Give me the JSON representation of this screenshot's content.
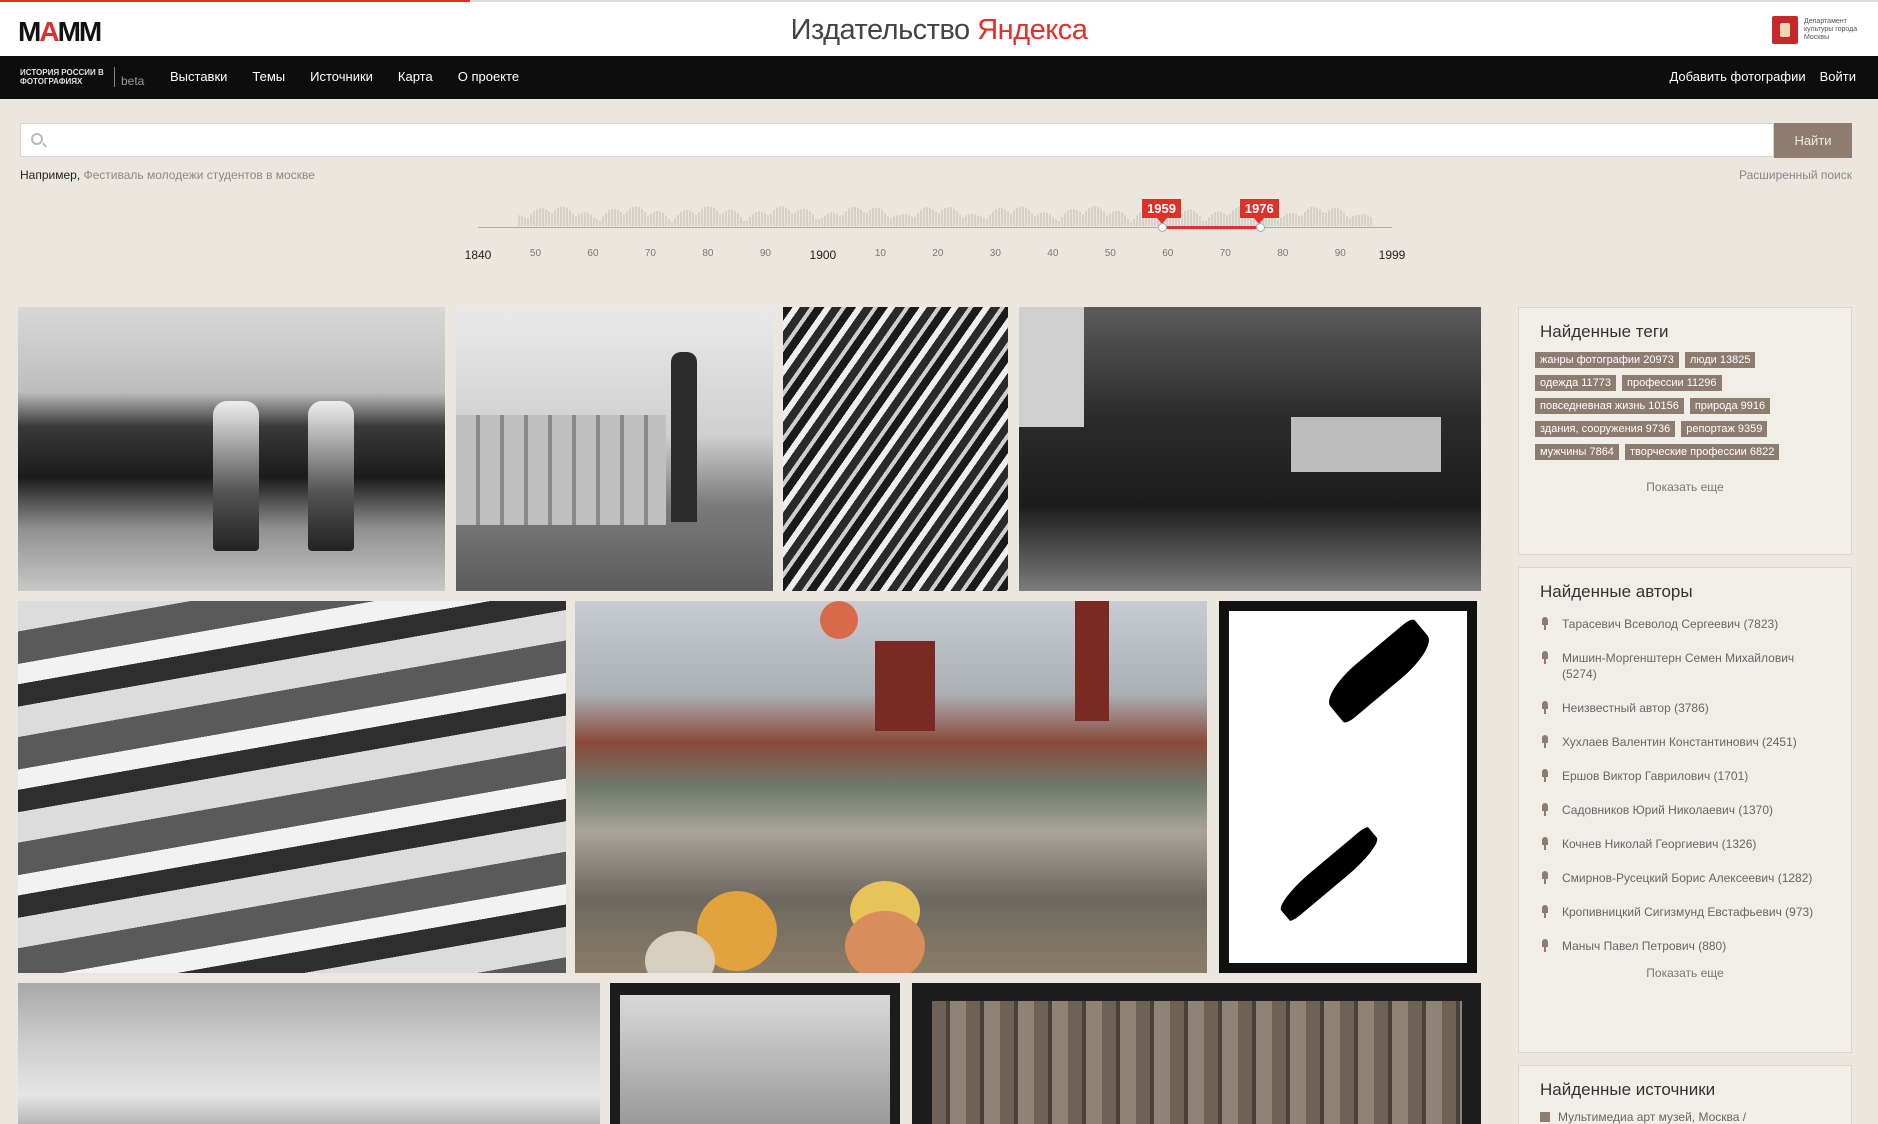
{
  "header": {
    "logo": "MAMM",
    "publisher_prefix": "Издательство ",
    "publisher_brand": "Яндекса",
    "department_text": "Департамент культуры города Москвы"
  },
  "nav": {
    "brand_line": "ИСТОРИЯ РОССИИ В ФОТОГРАФИЯХ",
    "beta": "beta",
    "items": [
      {
        "label": "Выставки"
      },
      {
        "label": "Темы"
      },
      {
        "label": "Источники"
      },
      {
        "label": "Карта"
      },
      {
        "label": "О проекте"
      }
    ],
    "add_photos": "Добавить фотографии",
    "login": "Войти"
  },
  "search": {
    "value": "",
    "button": "Найти",
    "example_label": "Например,",
    "example_text": "Фестиваль молодежи студентов в москве",
    "advanced": "Расширенный поиск"
  },
  "timeline": {
    "start_year": 1840,
    "end_year": 1999,
    "selected_from": "1959",
    "selected_to": "1976",
    "tick_labels": [
      "1840",
      "50",
      "60",
      "70",
      "80",
      "90",
      "1900",
      "10",
      "20",
      "30",
      "40",
      "50",
      "60",
      "70",
      "80",
      "90",
      "1999"
    ]
  },
  "tags_panel": {
    "title": "Найденные теги",
    "tags": [
      {
        "label": "жанры фотографии 20973"
      },
      {
        "label": "люди 13825"
      },
      {
        "label": "одежда 11773"
      },
      {
        "label": "профессии 11296"
      },
      {
        "label": "повседневная жизнь 10156"
      },
      {
        "label": "природа 9916"
      },
      {
        "label": "здания, сооружения 9736"
      },
      {
        "label": "репортаж 9359"
      },
      {
        "label": "мужчины 7864"
      },
      {
        "label": "творческие профессии 6822"
      }
    ],
    "more": "Показать еще"
  },
  "authors_panel": {
    "title": "Найденные авторы",
    "authors": [
      {
        "name": "Тарасевич Всеволод Сергеевич (7823)"
      },
      {
        "name": "Мишин-Моргенштерн Семен Михайлович (5274)"
      },
      {
        "name": "Неизвестный автор (3786)"
      },
      {
        "name": "Хухлаев Валентин Константинович (2451)"
      },
      {
        "name": "Ершов Виктор Гаврилович (1701)"
      },
      {
        "name": "Садовников Юрий Николаевич (1370)"
      },
      {
        "name": "Кочнев Николай Георгиевич (1326)"
      },
      {
        "name": "Смирнов-Русецкий Борис Алексеевич (1282)"
      },
      {
        "name": "Кропивницкий Сигизмунд Евстафьевич (973)"
      },
      {
        "name": "Маныч Павел Петрович (880)"
      }
    ],
    "more": "Показать еще"
  },
  "sources_panel": {
    "title": "Найденные источники",
    "first_item": "Мультимедиа арт музей, Москва /"
  },
  "colors": {
    "accent_red": "#e0302a",
    "tag_brown": "#8d7c6f",
    "page_bg": "#ebe7df"
  }
}
